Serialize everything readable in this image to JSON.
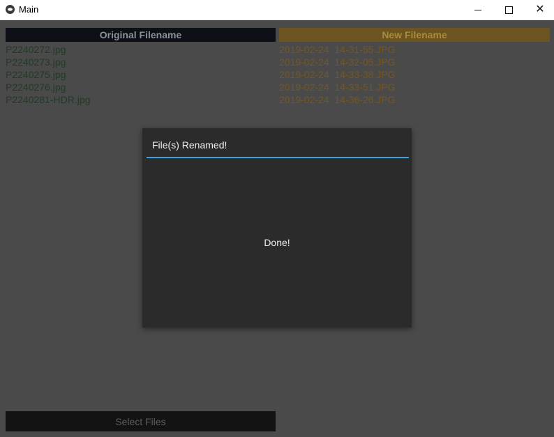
{
  "window": {
    "title": "Main",
    "controls": {
      "minimize": "minimize-icon",
      "maximize": "maximize-icon",
      "close": "close-icon"
    }
  },
  "headers": {
    "original": "Original Filename",
    "new": "New Filename"
  },
  "original_files": [
    "P2240272.jpg",
    "P2240273.jpg",
    "P2240275.jpg",
    "P2240276.jpg",
    "P2240281-HDR.jpg"
  ],
  "new_files": [
    "2019-02-24  14-31-55.JPG",
    "2019-02-24  14-32-05.JPG",
    "2019-02-24  14-33-38.JPG",
    "2019-02-24  14-33-51.JPG",
    "2019-02-24  14-36-26.JPG"
  ],
  "select_button": "Select Files",
  "modal": {
    "title": "File(s) Renamed!",
    "message": "Done!"
  },
  "colors": {
    "original_header": "#0c1016",
    "new_header": "#6b5420",
    "accent_line": "#33a5e0",
    "modal_bg": "#2b2b2b"
  }
}
